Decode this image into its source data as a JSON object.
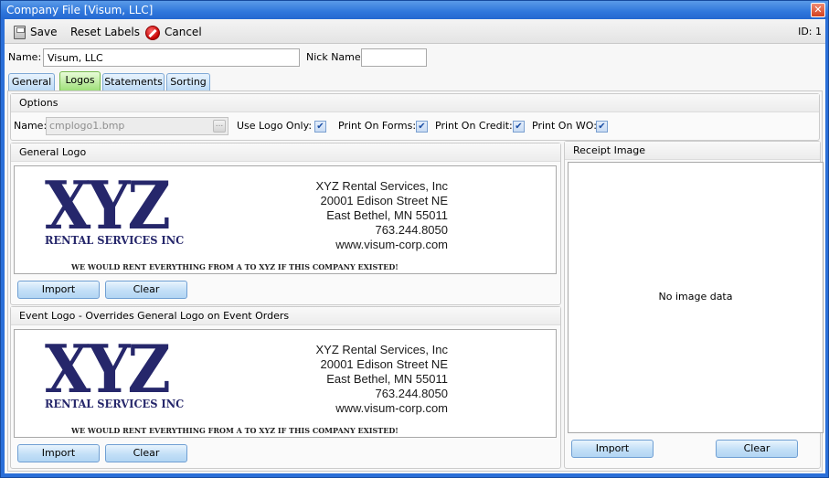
{
  "window": {
    "title": "Company File [Visum, LLC]",
    "close_icon": "close-icon"
  },
  "toolbar": {
    "save_label": "Save",
    "reset_labels_label": "Reset Labels",
    "cancel_label": "Cancel",
    "id_label": "ID: 1",
    "icons": {
      "save": "floppy-disk-icon",
      "cancel": "cancel-icon"
    }
  },
  "header": {
    "name_label": "Name:",
    "name_value": "Visum, LLC",
    "nick_name_label": "Nick Name:",
    "nick_name_value": ""
  },
  "tabs": [
    {
      "label": "General",
      "active": false
    },
    {
      "label": "Logos",
      "active": true
    },
    {
      "label": "Statements",
      "active": false
    },
    {
      "label": "Sorting",
      "active": false
    }
  ],
  "options": {
    "title": "Options",
    "name_label": "Name:",
    "file_name": "cmplogo1.bmp",
    "browse_label": "...",
    "use_logo_only_label": "Use Logo Only:",
    "use_logo_only": true,
    "print_on_forms_label": "Print On Forms:",
    "print_on_forms": true,
    "print_on_credit_label": "Print On Credit:",
    "print_on_credit": true,
    "print_on_wo_label": "Print On WO:",
    "print_on_wo": true,
    "check_mark": "✔"
  },
  "logo_content": {
    "big_text": "XYZ",
    "sub_text": "RENTAL SERVICES INC",
    "tagline": "WE WOULD RENT EVERYTHING FROM A TO XYZ IF THIS COMPANY EXISTED!",
    "address_lines": [
      "XYZ Rental Services, Inc",
      "20001 Edison Street NE",
      "East Bethel, MN 55011",
      "763.244.8050",
      "www.visum-corp.com"
    ],
    "brand_color": "#26276b"
  },
  "general_logo": {
    "title": "General Logo",
    "import_label": "Import",
    "clear_label": "Clear"
  },
  "event_logo": {
    "title": "Event Logo - Overrides General Logo on Event Orders",
    "import_label": "Import",
    "clear_label": "Clear"
  },
  "receipt_image": {
    "title": "Receipt Image",
    "empty_text": "No image data",
    "import_label": "Import",
    "clear_label": "Clear"
  }
}
